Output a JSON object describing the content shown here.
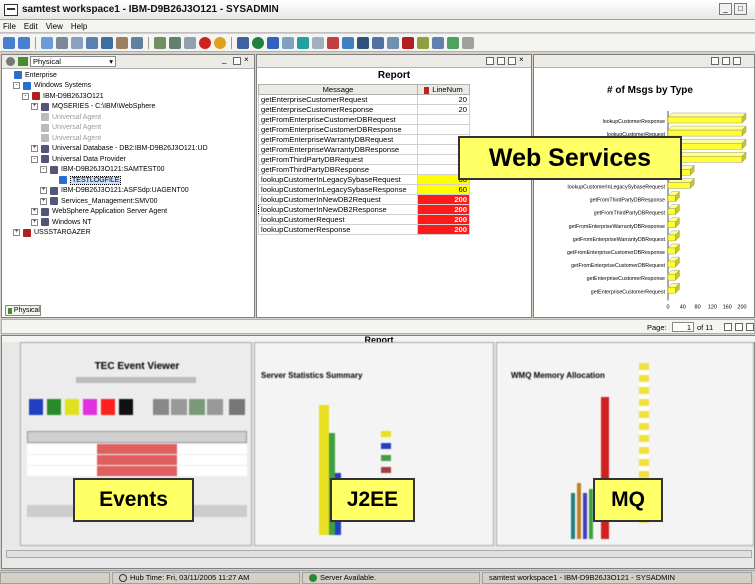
{
  "window": {
    "title": "samtest workspace1 - IBM-D9B26J3O121 - SYSADMIN",
    "controls": [
      "_",
      "□",
      "×"
    ]
  },
  "menu": [
    "File",
    "Edit",
    "View",
    "Help"
  ],
  "navigator": {
    "view_select": "Physical",
    "tab_label": "Physical",
    "tree": [
      {
        "label": "Enterprise",
        "indent": 0,
        "icon": "#2a6fd0",
        "exp": ""
      },
      {
        "label": "Windows Systems",
        "indent": 1,
        "icon": "#2a6fd0",
        "exp": "-"
      },
      {
        "label": "IBM-D9B26J3O121",
        "indent": 2,
        "icon": "#b02020",
        "exp": "-"
      },
      {
        "label": "MQSERIES - C:\\IBM\\WebSphere",
        "indent": 3,
        "icon": "#557",
        "exp": "+"
      },
      {
        "label": "Universal Agent",
        "indent": 3,
        "icon": "#bbb",
        "exp": "",
        "dim": true
      },
      {
        "label": "Universal Agent",
        "indent": 3,
        "icon": "#bbb",
        "exp": "",
        "dim": true
      },
      {
        "label": "Universal Agent",
        "indent": 3,
        "icon": "#bbb",
        "exp": "",
        "dim": true
      },
      {
        "label": "Universal Database - DB2:IBM-D9B26J3O121:UD",
        "indent": 3,
        "icon": "#557",
        "exp": "+"
      },
      {
        "label": "Universal Data Provider",
        "indent": 3,
        "icon": "#557",
        "exp": "-"
      },
      {
        "label": "IBM-D9B26J3O121:SAMTEST00",
        "indent": 4,
        "icon": "#557",
        "exp": "-"
      },
      {
        "label": "TESTLOGFILE",
        "indent": 5,
        "icon": "#2a6fd0",
        "exp": "",
        "sel": true
      },
      {
        "label": "IBM-D9B26J3O121:ASFSdp:UAGENT00",
        "indent": 4,
        "icon": "#557",
        "exp": "+"
      },
      {
        "label": "Services_Management:SMV00",
        "indent": 4,
        "icon": "#557",
        "exp": "+"
      },
      {
        "label": "WebSphere Application Server Agent",
        "indent": 3,
        "icon": "#557",
        "exp": "+"
      },
      {
        "label": "Windows NT",
        "indent": 3,
        "icon": "#557",
        "exp": "+"
      },
      {
        "label": "USSSTARGAZER",
        "indent": 1,
        "icon": "#b02020",
        "exp": "+"
      }
    ]
  },
  "report": {
    "title": "Report",
    "col_message": "Message",
    "col_linenum": "LineNum",
    "rows": [
      {
        "message": "getEnterpriseCustomerRequest",
        "line": "20",
        "hl": ""
      },
      {
        "message": "getEnterpriseCustomerResponse",
        "line": "20",
        "hl": ""
      },
      {
        "message": "getFromEnterpriseCustomerDBRequest",
        "line": "",
        "hl": ""
      },
      {
        "message": "getFromEnterpriseCustomerDBResponse",
        "line": "",
        "hl": ""
      },
      {
        "message": "getFromEnterpriseWarrantyDBRequest",
        "line": "",
        "hl": ""
      },
      {
        "message": "getFromEnterpriseWarrantyDBResponse",
        "line": "",
        "hl": ""
      },
      {
        "message": "getFromThirdPartyDBRequest",
        "line": "",
        "hl": ""
      },
      {
        "message": "getFromThirdPartyDBResponse",
        "line": "",
        "hl": ""
      },
      {
        "message": "lookupCustomerInLegacySybaseRequest",
        "line": "60",
        "hl": "yellow"
      },
      {
        "message": "lookupCustomerInLegacySybaseResponse",
        "line": "60",
        "hl": "yellow"
      },
      {
        "message": "lookupCustomerInNewDB2Request",
        "line": "200",
        "hl": "red"
      },
      {
        "message": "lookupCustomerInNewDB2Response",
        "line": "200",
        "hl": "red"
      },
      {
        "message": "lookupCustomerRequest",
        "line": "200",
        "hl": "red"
      },
      {
        "message": "lookupCustomerResponse",
        "line": "200",
        "hl": "red"
      }
    ]
  },
  "chart_data": {
    "type": "bar",
    "orientation": "horizontal",
    "title": "# of Msgs by Type",
    "categories": [
      "lookupCustomerResponse",
      "lookupCustomerRequest",
      "lookupCustomerInNewDB2Response",
      "lookupCustomerInNewDB2Request",
      "lookupCustomerInLegacySybaseResponse",
      "lookupCustomerInLegacySybaseRequest",
      "getFromThirdPartyDBResponse",
      "getFromThirdPartyDBRequest",
      "getFromEnterpriseWarrantyDBResponse",
      "getFromEnterpriseWarrantyDBRequest",
      "getFromEnterpriseCustomerDBResponse",
      "getFromEnterpriseCustomerDBRequest",
      "getEnterpriseCustomerResponse",
      "getEnterpriseCustomerRequest"
    ],
    "values": [
      200,
      200,
      200,
      200,
      60,
      60,
      20,
      20,
      20,
      20,
      20,
      20,
      20,
      20
    ],
    "xticks": [
      "0",
      "40",
      "80",
      "120",
      "160",
      "200"
    ],
    "xlim": [
      0,
      200
    ],
    "bar_color": "#ffff33"
  },
  "pager": {
    "label": "Page:",
    "value": "1",
    "suffix": "of 11"
  },
  "bottom": {
    "report_title": "Report",
    "tec_title": "TEC Event Viewer",
    "server_title": "Server Statistics Summary",
    "wmq_title": "WMQ Memory Allocation"
  },
  "overlays": {
    "web_services": "Web Services",
    "events": "Events",
    "j2ee": "J2EE",
    "mq": "MQ"
  },
  "status": {
    "hub_time": "Hub Time: Fri, 03/11/2005 11:27 AM",
    "server": "Server Available.",
    "workspace": "samtest workspace1 - IBM-D9B26J3O121 - SYSADMIN"
  },
  "colors": {
    "chart_bar": "#ffff33",
    "red_cell": "#ff1a1a",
    "yellow_cell": "#ffff00",
    "overlay": "#ffff66"
  }
}
